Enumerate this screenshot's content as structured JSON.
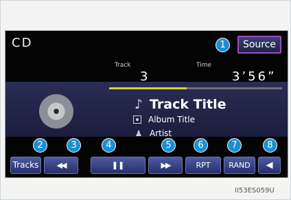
{
  "header": {
    "title": "CD",
    "source_label": "Source"
  },
  "playback": {
    "track_label": "Track",
    "track_number": "3",
    "time_label": "Time",
    "time_value": "3’56”",
    "progress_fraction": 0.45
  },
  "media": {
    "track_title": "Track Title",
    "album_title": "Album Title",
    "artist": "Artist"
  },
  "controls": {
    "tracks_label": "Tracks",
    "prev_icon": "◀◀",
    "pause_icon": "❚❚",
    "next_icon": "▶▶",
    "rpt_label": "RPT",
    "rand_label": "RAND",
    "volume_icon": "◀"
  },
  "callouts": [
    "1",
    "2",
    "3",
    "4",
    "5",
    "6",
    "7",
    "8"
  ],
  "caption": "II53ES059U",
  "colors": {
    "callout_blue": "#1b8fd0",
    "source_border": "#9a4fc1",
    "progress_yellow": "#d8d22c"
  }
}
